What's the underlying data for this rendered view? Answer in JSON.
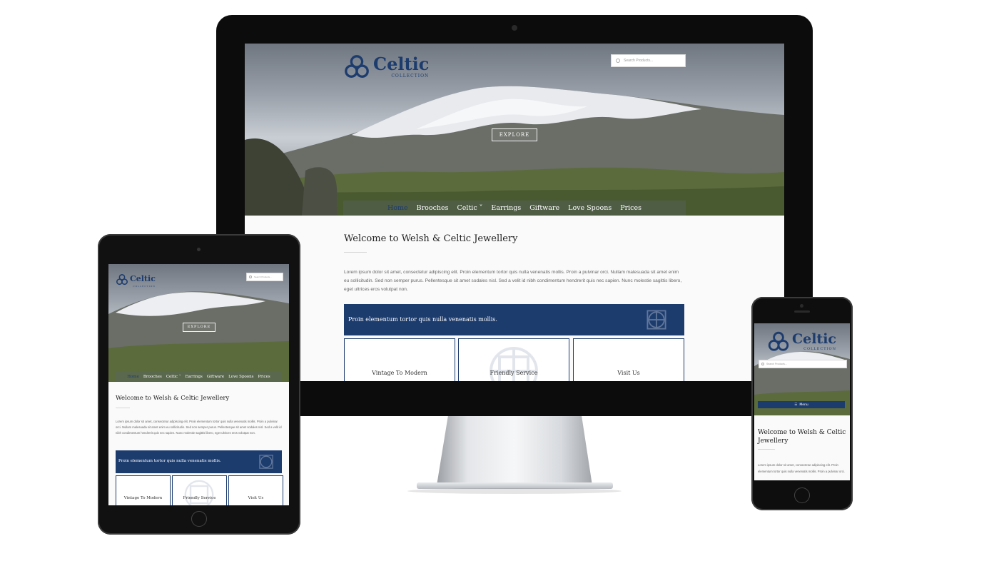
{
  "site": {
    "logo_text": "Celtic",
    "logo_sub": "COLLECTION",
    "search_placeholder": "Search Products...",
    "explore_label": "EXPLORE",
    "menu_label": "Menu",
    "nav": [
      {
        "label": "Home",
        "active": true
      },
      {
        "label": "Brooches",
        "active": false
      },
      {
        "label": "Celtic ˅",
        "active": false
      },
      {
        "label": "Earrings",
        "active": false
      },
      {
        "label": "Giftware",
        "active": false
      },
      {
        "label": "Love Spoons",
        "active": false
      },
      {
        "label": "Prices",
        "active": false
      }
    ],
    "welcome_title": "Welcome to Welsh & Celtic Jewellery",
    "lorem": "Lorem ipsum dolor sit amet, consectetur adipiscing elit. Proin elementum tortor quis nulla venenatis mollis. Proin a pulvinar orci. Nullam malesuada sit amet enim eu sollicitudin. Sed non semper purus. Pellentesque sit amet sodales nisl. Sed a velit id nibh condimentum hendrerit quis nec sapien. Nunc molestie sagittis libero, eget ultrices eros volutpat non.",
    "lorem_phone": "Lorem ipsum dolor sit amet, consectetur adipiscing elit. Proin elementum tortor quis nulla venenatis mollis. Proin a pulvinar orci.",
    "banner_text": "Proin elementum tortor quis nulla venenatis mollis.",
    "boxes": [
      "Vintage To Modern",
      "Friendly Service",
      "Visit Us"
    ]
  },
  "colors": {
    "brand_navy": "#1d3c6e",
    "device_black": "#0c0c0c"
  }
}
